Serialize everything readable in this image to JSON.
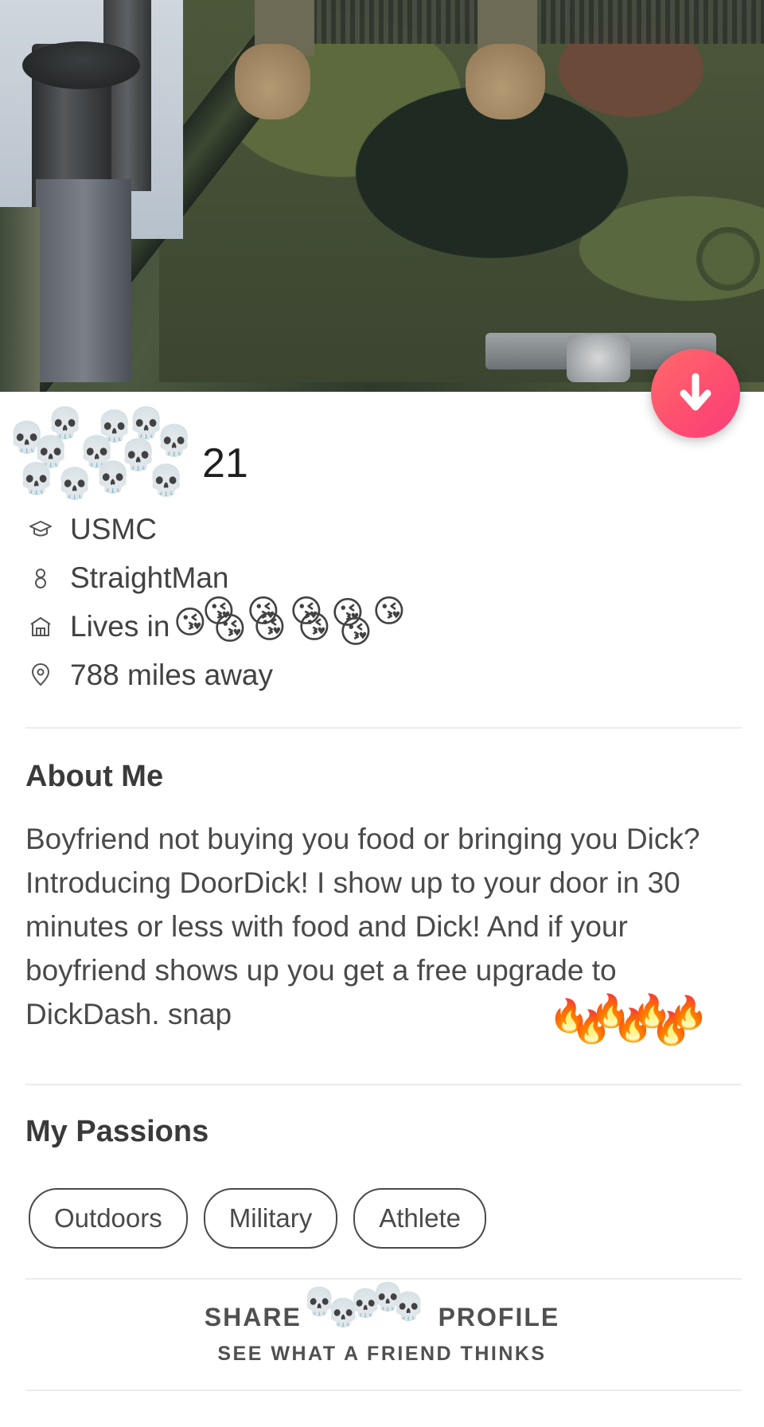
{
  "profile": {
    "age": "21",
    "info": {
      "school": "USMC",
      "gender": "StraightMan",
      "lives_in_prefix": "Lives in",
      "distance": "788 miles away"
    },
    "about": {
      "title": "About Me",
      "text": "Boyfriend not buying you food or bringing you Dick? Introducing DoorDick! I show up to your door in 30 minutes or less with food and Dick! And if your boyfriend shows up you get a free upgrade to DickDash. snap"
    },
    "passions": {
      "title": "My Passions",
      "items": [
        "Outdoors",
        "Military",
        "Athlete"
      ]
    },
    "share": {
      "title_left": "SHARE",
      "title_right": "PROFILE",
      "subtitle": "SEE WHAT A FRIEND THINKS"
    }
  },
  "emoji": {
    "name_overlay": "💀",
    "city_overlay": "😘",
    "snap_overlay": "🔥",
    "share_overlay": "💀"
  },
  "icons": {
    "fab": "arrow-down-icon",
    "school": "graduation-cap-icon",
    "gender": "person-icon",
    "home": "home-icon",
    "location": "location-pin-icon"
  },
  "colors": {
    "fab_gradient_start": "#ff6b6b",
    "fab_gradient_end": "#f93d7c",
    "text": "#424242"
  }
}
